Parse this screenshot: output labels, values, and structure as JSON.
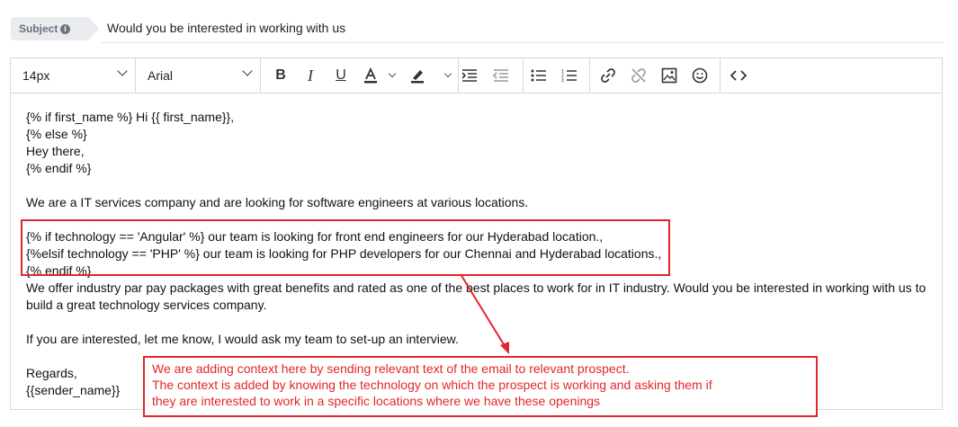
{
  "subject": {
    "label": "Subject",
    "value": "Would you be interested in working with us"
  },
  "toolbar": {
    "font_size": "14px",
    "font_family": "Arial",
    "buttons": [
      "bold-icon",
      "italic-icon",
      "underline-icon",
      "text-color-icon",
      "highlight-icon",
      "indent-icon",
      "outdent-icon",
      "bullet-list-icon",
      "numbered-list-icon",
      "link-icon",
      "unlink-icon",
      "image-icon",
      "emoji-icon",
      "code-icon"
    ]
  },
  "body": {
    "lines": [
      "{% if first_name %} Hi {{ first_name}},",
      "{% else %}",
      "Hey there,",
      "{% endif %}",
      "",
      "We are a IT services company and are looking for software engineers at various locations.",
      "",
      "{% if technology == 'Angular' %} our team is looking for front end engineers for our Hyderabad location.,",
      "{%elsif technology == 'PHP' %} our team is looking for PHP developers for our Chennai and Hyderabad locations.,",
      "{% endif %}",
      "We offer industry par pay packages with great benefits and rated as one of the best places to work for in IT industry. Would you be interested in working with us to",
      "build a great technology services company.",
      "",
      "If you are interested, let me know, I would ask my team to set-up an interview.",
      "",
      "Regards,",
      "{{sender_name}}"
    ]
  },
  "annotation": {
    "line1": "We are adding context here by sending relevant text of the email to relevant prospect.",
    "line2": "The context is added by knowing the technology on which the prospect is working and asking them if",
    "line3": "they are interested to work in a specific locations where we have these openings",
    "color": "#e3262b"
  }
}
